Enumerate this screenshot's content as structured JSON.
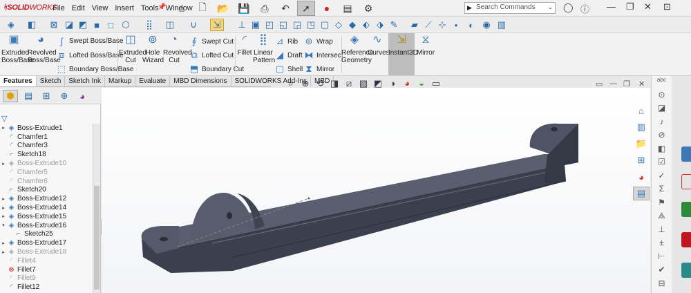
{
  "app": {
    "logo_brand": "SOLID",
    "logo_rest": "WORKS"
  },
  "menu": [
    "File",
    "Edit",
    "View",
    "Insert",
    "Tools",
    "Window"
  ],
  "search": {
    "placeholder": "Search Commands"
  },
  "command_manager": {
    "extruded_boss": "Extruded Boss/Base",
    "revolved_boss": "Revolved Boss/Base",
    "swept_boss": "Swept Boss/Base",
    "lofted_boss": "Lofted Boss/Base",
    "boundary_boss": "Boundary Boss/Base",
    "extruded_cut": "Extruded Cut",
    "hole_wizard": "Hole Wizard",
    "revolved_cut": "Revolved Cut",
    "swept_cut": "Swept Cut",
    "lofted_cut": "Lofted Cut",
    "boundary_cut": "Boundary Cut",
    "fillet": "Fillet",
    "linear_pattern": "Linear Pattern",
    "rib": "Rib",
    "draft": "Draft",
    "shell": "Shell",
    "wrap": "Wrap",
    "intersect": "Intersect",
    "mirror_small": "Mirror",
    "reference_geometry": "Reference Geometry",
    "curves": "Curves",
    "instant3d": "Instant3D",
    "mirror": "Mirror"
  },
  "tabs": [
    "Features",
    "Sketch",
    "Sketch Ink",
    "Markup",
    "Evaluate",
    "MBD Dimensions",
    "SOLIDWORKS Add-Ins",
    "MBD"
  ],
  "tree": [
    {
      "label": "Boss-Extrude1",
      "state": "normal",
      "expand": true
    },
    {
      "label": "Chamfer1",
      "state": "normal",
      "expand": false
    },
    {
      "label": "Chamfer3",
      "state": "normal",
      "expand": false
    },
    {
      "label": "Sketch18",
      "state": "normal",
      "expand": false
    },
    {
      "label": "Boss-Extrude10",
      "state": "suppressed",
      "expand": true
    },
    {
      "label": "Chamfer5",
      "state": "suppressed",
      "expand": false
    },
    {
      "label": "Chamfer6",
      "state": "suppressed",
      "expand": false
    },
    {
      "label": "Sketch20",
      "state": "normal",
      "expand": false
    },
    {
      "label": "Boss-Extrude12",
      "state": "normal",
      "expand": true
    },
    {
      "label": "Boss-Extrude14",
      "state": "normal",
      "expand": true
    },
    {
      "label": "Boss-Extrude15",
      "state": "normal",
      "expand": true
    },
    {
      "label": "Boss-Extrude16",
      "state": "normal",
      "expand": true,
      "open": true
    },
    {
      "label": "Sketch25",
      "state": "normal",
      "expand": false,
      "child": true
    },
    {
      "label": "Boss-Extrude17",
      "state": "normal",
      "expand": true
    },
    {
      "label": "Boss-Extrude18",
      "state": "suppressed",
      "expand": true
    },
    {
      "label": "Fillet4",
      "state": "suppressed",
      "expand": false
    },
    {
      "label": "Fillet7",
      "state": "error",
      "expand": false
    },
    {
      "label": "Fillet9",
      "state": "suppressed",
      "expand": false
    },
    {
      "label": "Fillet12",
      "state": "normal",
      "expand": false
    }
  ]
}
